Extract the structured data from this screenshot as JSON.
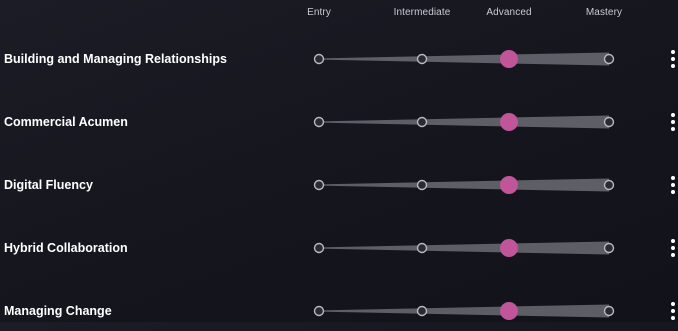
{
  "levels": [
    "Entry",
    "Intermediate",
    "Advanced",
    "Mastery"
  ],
  "skills": [
    {
      "name": "Building and Managing Relationships",
      "level": "Advanced"
    },
    {
      "name": "Commercial Acumen",
      "level": "Advanced"
    },
    {
      "name": "Digital Fluency",
      "level": "Advanced"
    },
    {
      "name": "Hybrid Collaboration",
      "level": "Advanced"
    },
    {
      "name": "Managing Change",
      "level": "Advanced"
    }
  ],
  "icons": {
    "row_menu": "more-vertical-icon"
  },
  "colors": {
    "selected": "#c0559a",
    "node_fill": "#2a2a33",
    "node_stroke": "#b9b9c2",
    "track": "#9a9aa4"
  }
}
